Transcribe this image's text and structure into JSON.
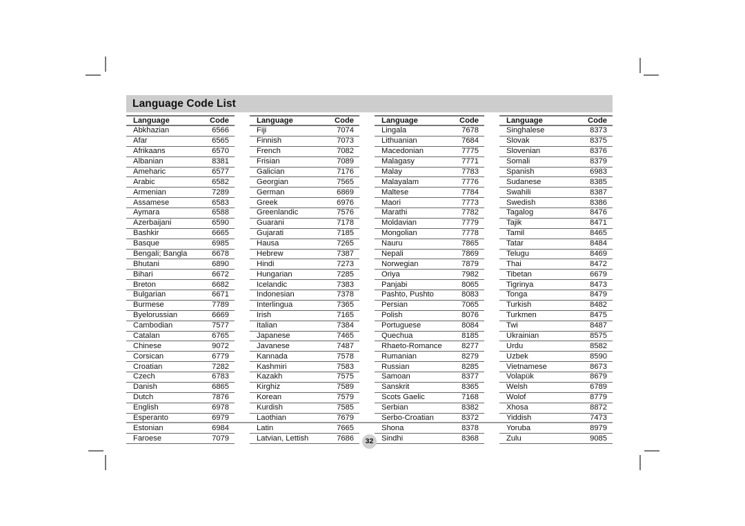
{
  "title": "Language Code List",
  "headers": {
    "language": "Language",
    "code": "Code"
  },
  "page_number": "32",
  "columns": [
    {
      "rows": [
        {
          "language": "Abkhazian",
          "code": "6566"
        },
        {
          "language": "Afar",
          "code": "6565"
        },
        {
          "language": "Afrikaans",
          "code": "6570"
        },
        {
          "language": "Albanian",
          "code": "8381"
        },
        {
          "language": "Ameharic",
          "code": "6577"
        },
        {
          "language": "Arabic",
          "code": "6582"
        },
        {
          "language": "Armenian",
          "code": "7289"
        },
        {
          "language": "Assamese",
          "code": "6583"
        },
        {
          "language": "Aymara",
          "code": "6588"
        },
        {
          "language": "Azerbaijani",
          "code": "6590"
        },
        {
          "language": "Bashkir",
          "code": "6665"
        },
        {
          "language": "Basque",
          "code": "6985"
        },
        {
          "language": "Bengali; Bangla",
          "code": "6678"
        },
        {
          "language": "Bhutani",
          "code": "6890"
        },
        {
          "language": "Bihari",
          "code": "6672"
        },
        {
          "language": "Breton",
          "code": "6682"
        },
        {
          "language": "Bulgarian",
          "code": "6671"
        },
        {
          "language": "Burmese",
          "code": "7789"
        },
        {
          "language": "Byelorussian",
          "code": "6669"
        },
        {
          "language": "Cambodian",
          "code": "7577"
        },
        {
          "language": "Catalan",
          "code": "6765"
        },
        {
          "language": "Chinese",
          "code": "9072"
        },
        {
          "language": "Corsican",
          "code": "6779"
        },
        {
          "language": "Croatian",
          "code": "7282"
        },
        {
          "language": "Czech",
          "code": "6783"
        },
        {
          "language": "Danish",
          "code": "6865"
        },
        {
          "language": "Dutch",
          "code": "7876"
        },
        {
          "language": "English",
          "code": "6978"
        },
        {
          "language": "Esperanto",
          "code": "6979"
        },
        {
          "language": "Estonian",
          "code": "6984"
        },
        {
          "language": "Faroese",
          "code": "7079"
        }
      ]
    },
    {
      "rows": [
        {
          "language": "Fiji",
          "code": "7074"
        },
        {
          "language": "Finnish",
          "code": "7073"
        },
        {
          "language": "French",
          "code": "7082"
        },
        {
          "language": "Frisian",
          "code": "7089"
        },
        {
          "language": "Galician",
          "code": "7176"
        },
        {
          "language": "Georgian",
          "code": "7565"
        },
        {
          "language": "German",
          "code": "6869"
        },
        {
          "language": "Greek",
          "code": "6976"
        },
        {
          "language": "Greenlandic",
          "code": "7576"
        },
        {
          "language": "Guarani",
          "code": "7178"
        },
        {
          "language": "Gujarati",
          "code": "7185"
        },
        {
          "language": "Hausa",
          "code": "7265"
        },
        {
          "language": "Hebrew",
          "code": "7387"
        },
        {
          "language": "Hindi",
          "code": "7273"
        },
        {
          "language": "Hungarian",
          "code": "7285"
        },
        {
          "language": "Icelandic",
          "code": "7383"
        },
        {
          "language": "Indonesian",
          "code": "7378"
        },
        {
          "language": "Interlingua",
          "code": "7365"
        },
        {
          "language": "Irish",
          "code": "7165"
        },
        {
          "language": "Italian",
          "code": "7384"
        },
        {
          "language": "Japanese",
          "code": "7465"
        },
        {
          "language": "Javanese",
          "code": "7487"
        },
        {
          "language": "Kannada",
          "code": "7578"
        },
        {
          "language": "Kashmiri",
          "code": "7583"
        },
        {
          "language": "Kazakh",
          "code": "7575"
        },
        {
          "language": "Kirghiz",
          "code": "7589"
        },
        {
          "language": "Korean",
          "code": "7579"
        },
        {
          "language": "Kurdish",
          "code": "7585"
        },
        {
          "language": "Laothian",
          "code": "7679"
        },
        {
          "language": "Latin",
          "code": "7665"
        },
        {
          "language": "Latvian, Lettish",
          "code": "7686"
        }
      ]
    },
    {
      "rows": [
        {
          "language": "Lingala",
          "code": "7678"
        },
        {
          "language": "Lithuanian",
          "code": "7684"
        },
        {
          "language": "Macedonian",
          "code": "7775"
        },
        {
          "language": "Malagasy",
          "code": "7771"
        },
        {
          "language": "Malay",
          "code": "7783"
        },
        {
          "language": "Malayalam",
          "code": "7776"
        },
        {
          "language": "Maltese",
          "code": "7784"
        },
        {
          "language": "Maori",
          "code": "7773"
        },
        {
          "language": "Marathi",
          "code": "7782"
        },
        {
          "language": "Moldavian",
          "code": "7779"
        },
        {
          "language": "Mongolian",
          "code": "7778"
        },
        {
          "language": "Nauru",
          "code": "7865"
        },
        {
          "language": "Nepali",
          "code": "7869"
        },
        {
          "language": "Norwegian",
          "code": "7879"
        },
        {
          "language": "Oriya",
          "code": "7982"
        },
        {
          "language": "Panjabi",
          "code": "8065"
        },
        {
          "language": "Pashto, Pushto",
          "code": "8083"
        },
        {
          "language": "Persian",
          "code": "7065"
        },
        {
          "language": "Polish",
          "code": "8076"
        },
        {
          "language": "Portuguese",
          "code": "8084"
        },
        {
          "language": "Quechua",
          "code": "8185"
        },
        {
          "language": "Rhaeto-Romance",
          "code": "8277"
        },
        {
          "language": "Rumanian",
          "code": "8279"
        },
        {
          "language": "Russian",
          "code": "8285"
        },
        {
          "language": "Samoan",
          "code": "8377"
        },
        {
          "language": "Sanskrit",
          "code": "8365"
        },
        {
          "language": "Scots Gaelic",
          "code": "7168"
        },
        {
          "language": "Serbian",
          "code": "8382"
        },
        {
          "language": "Serbo-Croatian",
          "code": "8372"
        },
        {
          "language": "Shona",
          "code": "8378"
        },
        {
          "language": "Sindhi",
          "code": "8368"
        }
      ]
    },
    {
      "rows": [
        {
          "language": "Singhalese",
          "code": "8373"
        },
        {
          "language": "Slovak",
          "code": "8375"
        },
        {
          "language": "Slovenian",
          "code": "8376"
        },
        {
          "language": "Somali",
          "code": "8379"
        },
        {
          "language": "Spanish",
          "code": "6983"
        },
        {
          "language": "Sudanese",
          "code": "8385"
        },
        {
          "language": "Swahili",
          "code": "8387"
        },
        {
          "language": "Swedish",
          "code": "8386"
        },
        {
          "language": "Tagalog",
          "code": "8476"
        },
        {
          "language": "Tajik",
          "code": "8471"
        },
        {
          "language": "Tamil",
          "code": "8465"
        },
        {
          "language": "Tatar",
          "code": "8484"
        },
        {
          "language": "Telugu",
          "code": "8469"
        },
        {
          "language": "Thai",
          "code": "8472"
        },
        {
          "language": "Tibetan",
          "code": "6679"
        },
        {
          "language": "Tigrinya",
          "code": "8473"
        },
        {
          "language": "Tonga",
          "code": "8479"
        },
        {
          "language": "Turkish",
          "code": "8482"
        },
        {
          "language": "Turkmen",
          "code": "8475"
        },
        {
          "language": "Twi",
          "code": "8487"
        },
        {
          "language": "Ukrainian",
          "code": "8575"
        },
        {
          "language": "Urdu",
          "code": "8582"
        },
        {
          "language": "Uzbek",
          "code": "8590"
        },
        {
          "language": "Vietnamese",
          "code": "8673"
        },
        {
          "language": "Volapük",
          "code": "8679"
        },
        {
          "language": "Welsh",
          "code": "6789"
        },
        {
          "language": "Wolof",
          "code": "8779"
        },
        {
          "language": "Xhosa",
          "code": "8872"
        },
        {
          "language": "Yiddish",
          "code": "7473"
        },
        {
          "language": "Yoruba",
          "code": "8979"
        },
        {
          "language": "Zulu",
          "code": "9085"
        }
      ]
    }
  ]
}
